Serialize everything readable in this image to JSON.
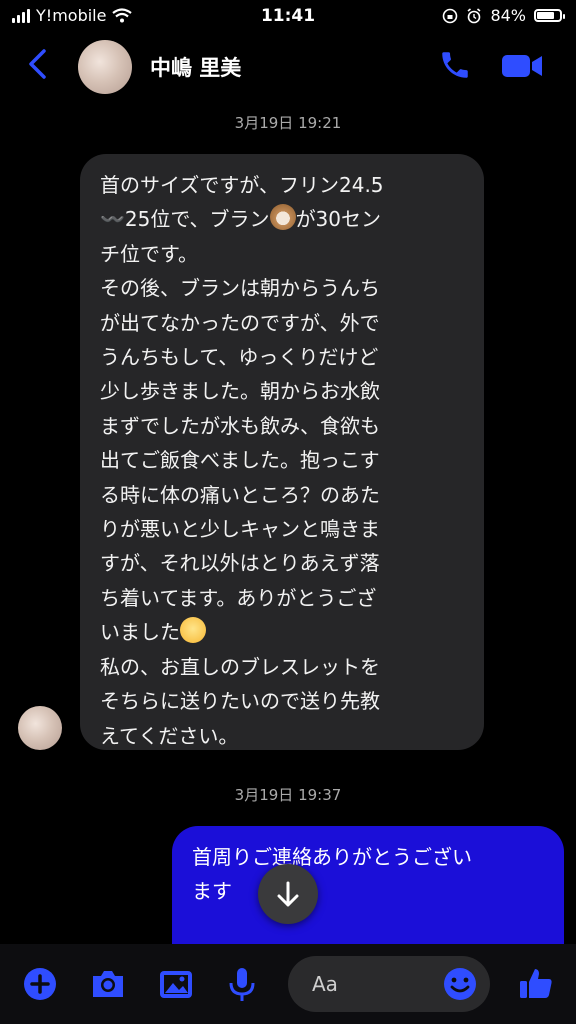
{
  "status_bar": {
    "carrier": "Y!mobile",
    "time": "11:41",
    "battery": "84%",
    "battery_level": 0.84
  },
  "header": {
    "contact_name": "中嶋 里美"
  },
  "messages": [
    {
      "timestamp": "3月19日 19:21"
    },
    {
      "timestamp": "3月19日 19:37"
    }
  ],
  "incoming_lines": [
    "首のサイズですが、フリン24.5",
    "〰️25位で、ブラン",
    "が30セン",
    "チ位です。",
    "その後、ブランは朝からうんち",
    "が出てなかったのですが、外で",
    "うんちもして、ゆっくりだけど",
    "少し歩きました。朝からお水飲",
    "まずでしたが水も飲み、食欲も",
    "出てご飯食べました。抱っこす",
    "る時に体の痛いところ？のあた",
    "りが悪いと少しキャンと鳴きま",
    "すが、それ以外はとりあえず落",
    "ち着いてます。ありがとうござ",
    "いました",
    "私の、お直しのブレスレットを",
    "そちらに送りたいので送り先教",
    "えてください。"
  ],
  "outgoing_lines": [
    "首周りご連絡ありがとうござい",
    "ます"
  ],
  "composer": {
    "placeholder": "Aa"
  },
  "colors": {
    "accent": "#2f4dff",
    "outgoing_bubble": "#1b0fd8",
    "incoming_bubble": "#262628"
  }
}
